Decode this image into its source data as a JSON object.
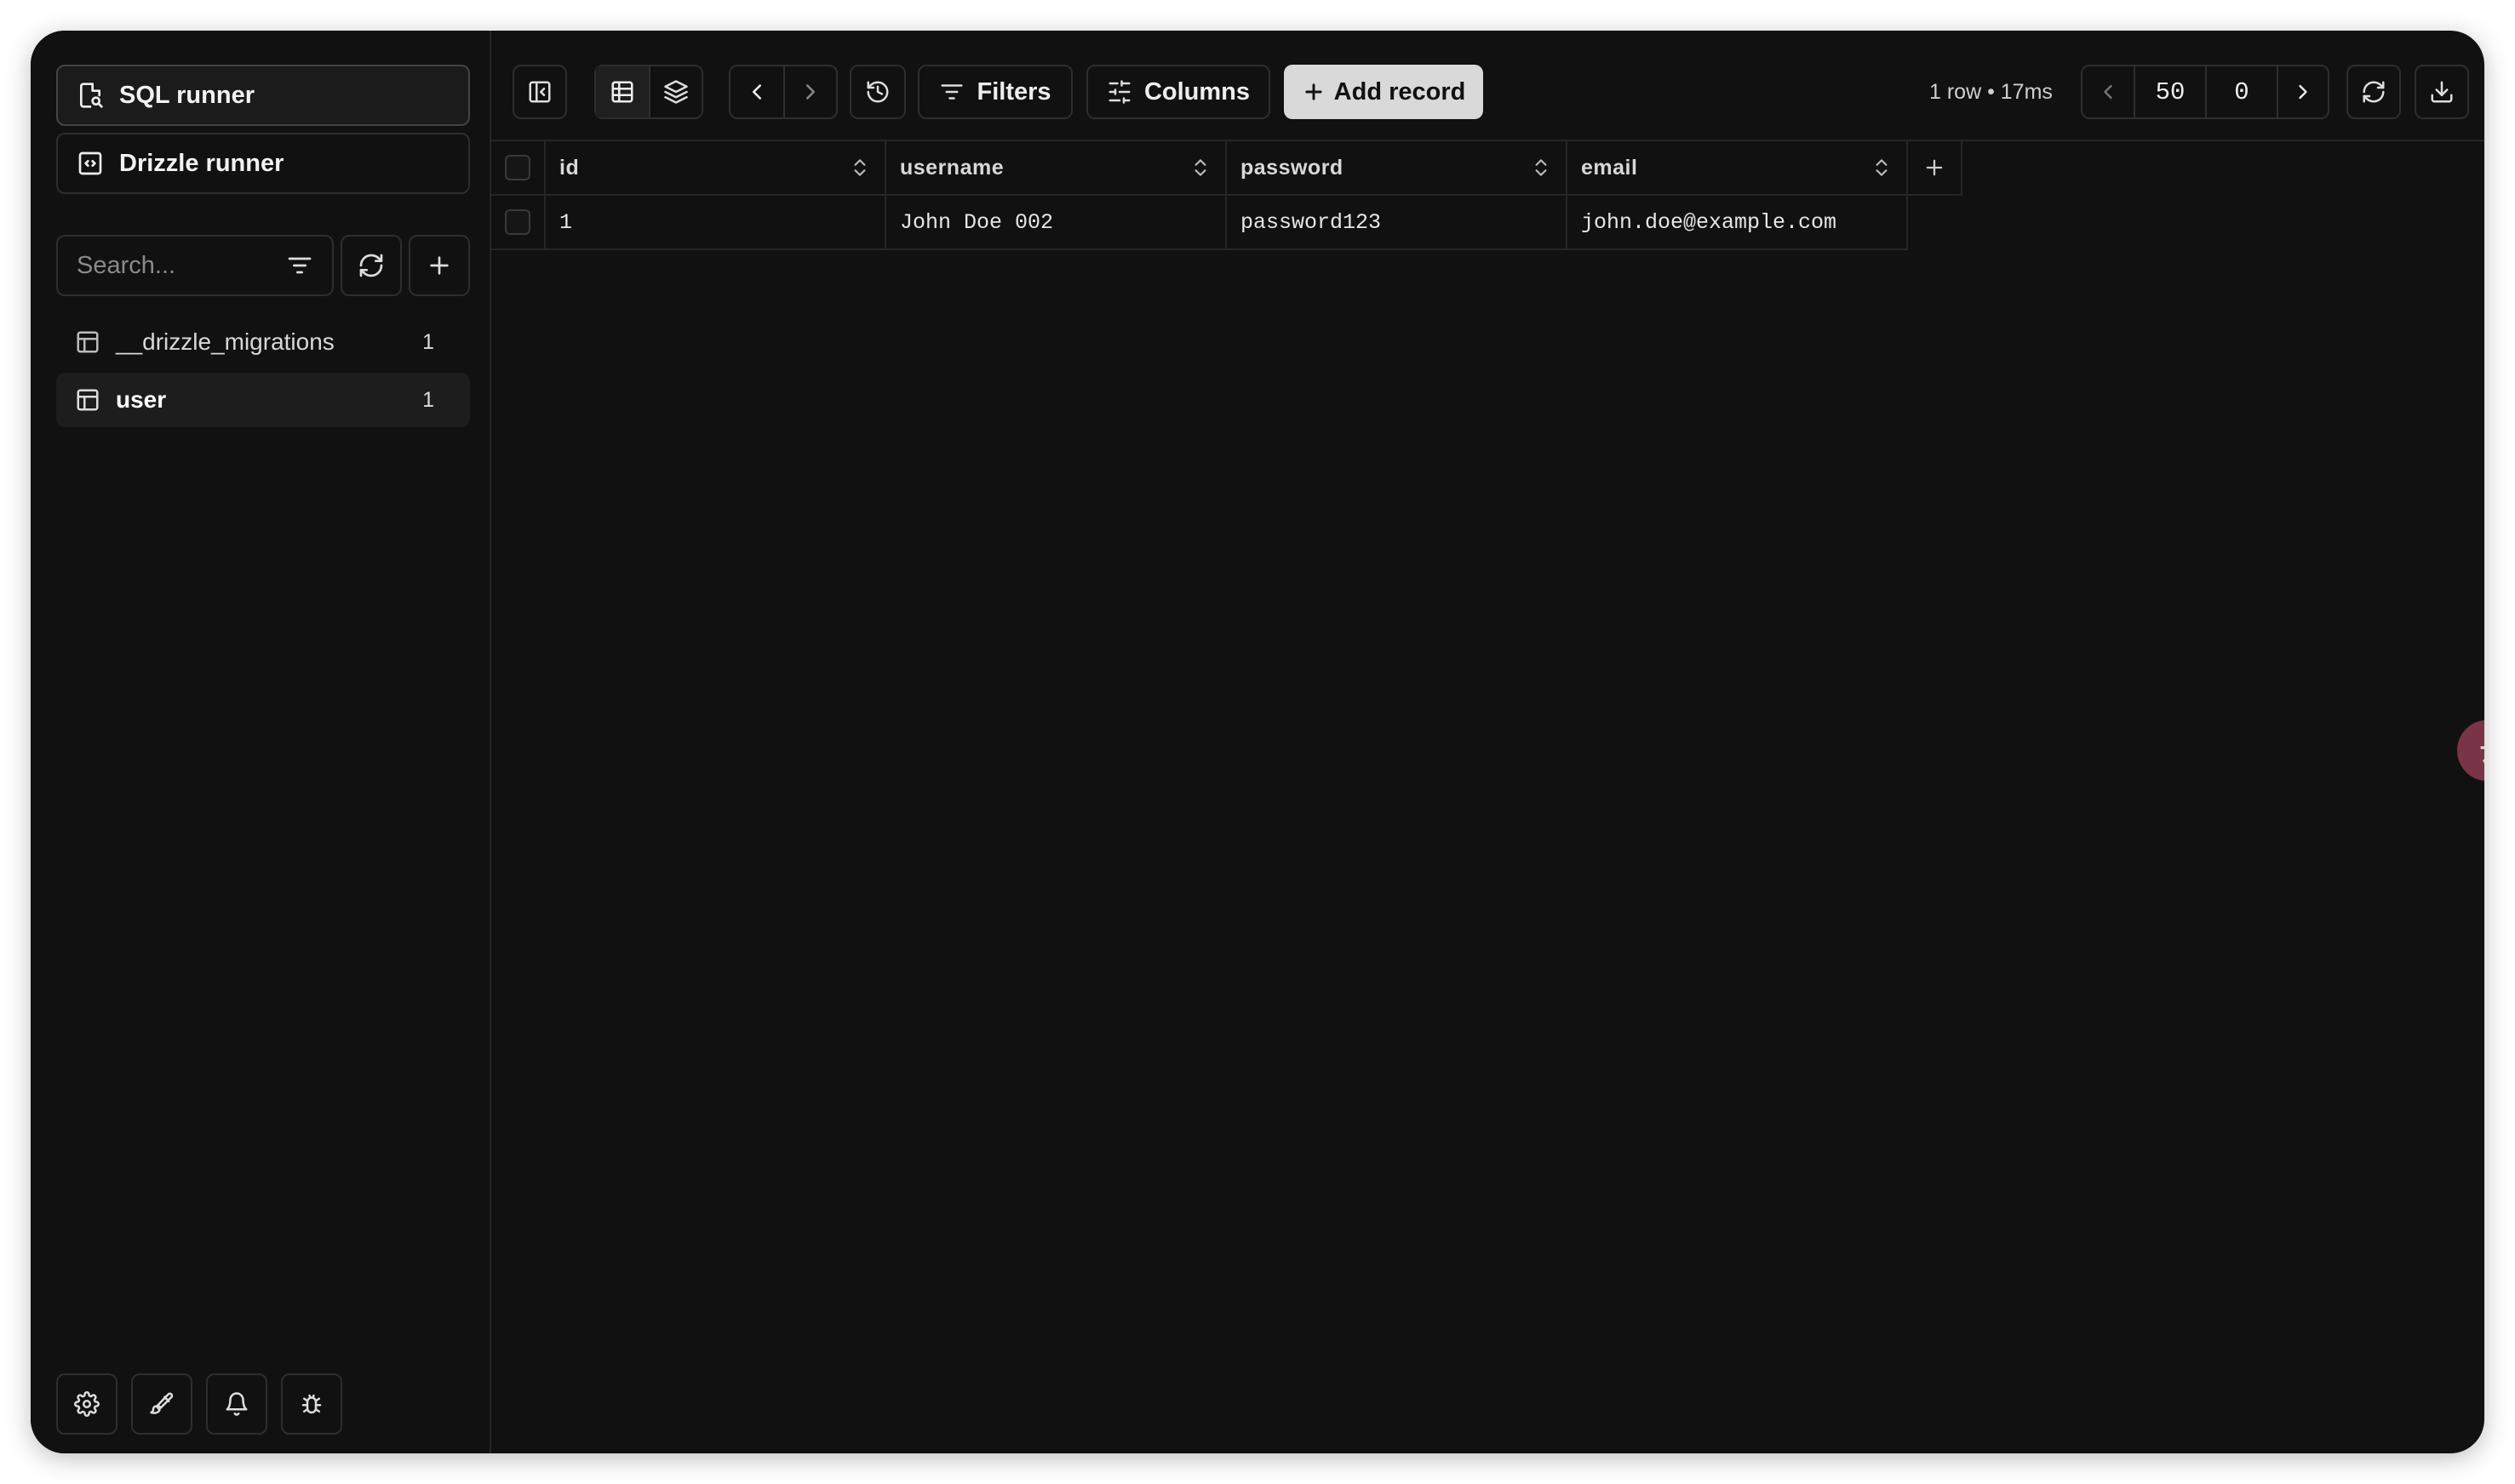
{
  "sidebar": {
    "sql_runner_label": "SQL runner",
    "drizzle_runner_label": "Drizzle runner",
    "search_placeholder": "Search...",
    "tables": [
      {
        "name": "__drizzle_migrations",
        "count": "1"
      },
      {
        "name": "user",
        "count": "1"
      }
    ]
  },
  "toolbar": {
    "filters_label": "Filters",
    "columns_label": "Columns",
    "add_record_label": "Add record",
    "row_info": "1 row • 17ms",
    "limit": "50",
    "offset": "0"
  },
  "table": {
    "columns": [
      "id",
      "username",
      "password",
      "email"
    ],
    "rows": [
      [
        "1",
        "John Doe 002",
        "password123",
        "john.doe@example.com"
      ]
    ]
  },
  "translate_badge": "ㄊA",
  "colors": {
    "background": "#111111",
    "border": "#2e2e2e",
    "add_record_bg": "#d9d9d9",
    "badge": "#7a3448"
  }
}
